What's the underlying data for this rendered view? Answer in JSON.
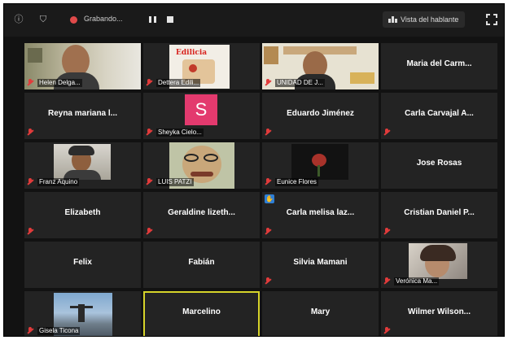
{
  "toolbar": {
    "recording_label": "Grabando...",
    "speaker_view_label": "Vista del hablante"
  },
  "participants": [
    {
      "name": "Helen Delga...",
      "type": "video"
    },
    {
      "name": "Dettera Edili...",
      "type": "video",
      "logo_text": "Edilicia"
    },
    {
      "name": "UNIDAD DE J...",
      "type": "video"
    },
    {
      "name": "Maria del Carm...",
      "type": "name"
    },
    {
      "name": "Reyna mariana l...",
      "type": "name"
    },
    {
      "name": "Sheyka Cielo...",
      "type": "avatar",
      "avatar_letter": "S",
      "avatar_color": "#e33a6e"
    },
    {
      "name": "Eduardo Jiménez",
      "type": "name"
    },
    {
      "name": "Carla Carvajal A...",
      "type": "name"
    },
    {
      "name": "Franz Aquino",
      "type": "video"
    },
    {
      "name": "LUIS PATZI",
      "type": "video"
    },
    {
      "name": "Eunice Flores",
      "type": "video"
    },
    {
      "name": "Jose Rosas",
      "type": "name"
    },
    {
      "name": "Elizabeth",
      "type": "name"
    },
    {
      "name": "Geraldine lizeth...",
      "type": "name"
    },
    {
      "name": "Carla melisa laz...",
      "type": "name",
      "hand_raised": true
    },
    {
      "name": "Cristian Daniel P...",
      "type": "name"
    },
    {
      "name": "Felix",
      "type": "name"
    },
    {
      "name": "Fabián",
      "type": "name"
    },
    {
      "name": "Silvia Mamani",
      "type": "name"
    },
    {
      "name": "Verónica Ma...",
      "type": "video"
    },
    {
      "name": "Gisela Ticona",
      "type": "video"
    },
    {
      "name": "Marcelino",
      "type": "name",
      "active_speaker": true
    },
    {
      "name": "Mary",
      "type": "name"
    },
    {
      "name": "Wilmer Wilson...",
      "type": "name"
    }
  ],
  "colors": {
    "background": "#121212",
    "tile": "#232323",
    "active_border": "#d6d32a",
    "muted_mic": "#e23b3b"
  }
}
